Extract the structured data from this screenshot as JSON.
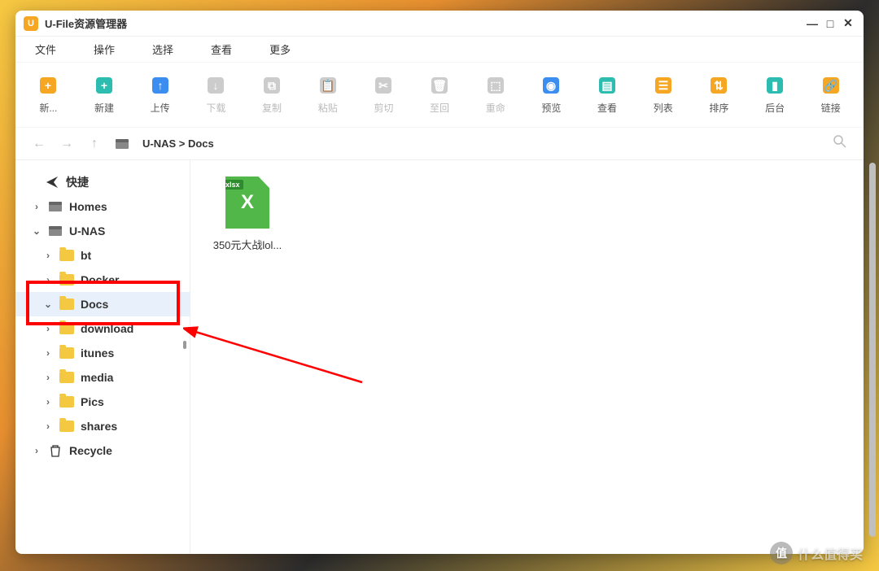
{
  "title": "U-File资源管理器",
  "titleBadge": "U",
  "windowControls": {
    "min": "—",
    "max": "□",
    "close": "✕"
  },
  "menu": [
    "文件",
    "操作",
    "选择",
    "查看",
    "更多"
  ],
  "toolbar": [
    {
      "id": "new-folder",
      "label": "新...",
      "color": "#f5a623",
      "enabled": true,
      "glyph": "+"
    },
    {
      "id": "new-file",
      "label": "新建",
      "color": "#2dbdb0",
      "enabled": true,
      "glyph": "+"
    },
    {
      "id": "upload",
      "label": "上传",
      "color": "#3b8ef0",
      "enabled": true,
      "glyph": "↑"
    },
    {
      "id": "download",
      "label": "下载",
      "color": "#ccc",
      "enabled": false,
      "glyph": "↓"
    },
    {
      "id": "copy",
      "label": "复制",
      "color": "#ccc",
      "enabled": false,
      "glyph": "⧉"
    },
    {
      "id": "paste",
      "label": "粘贴",
      "color": "#ccc",
      "enabled": false,
      "glyph": "📋"
    },
    {
      "id": "cut",
      "label": "剪切",
      "color": "#ccc",
      "enabled": false,
      "glyph": "✂"
    },
    {
      "id": "recycle",
      "label": "至回",
      "color": "#ccc",
      "enabled": false,
      "glyph": "🗑"
    },
    {
      "id": "rename",
      "label": "重命",
      "color": "#ccc",
      "enabled": false,
      "glyph": "⬚"
    },
    {
      "id": "preview",
      "label": "预览",
      "color": "#3b8ef0",
      "enabled": true,
      "glyph": "◉"
    },
    {
      "id": "view",
      "label": "查看",
      "color": "#2dbdb0",
      "enabled": true,
      "glyph": "▤"
    },
    {
      "id": "list",
      "label": "列表",
      "color": "#f5a623",
      "enabled": true,
      "glyph": "☰"
    },
    {
      "id": "sort",
      "label": "排序",
      "color": "#f5a623",
      "enabled": true,
      "glyph": "⇅"
    },
    {
      "id": "background",
      "label": "后台",
      "color": "#2dbdb0",
      "enabled": true,
      "glyph": "▮"
    },
    {
      "id": "link",
      "label": "链接",
      "color": "#f5a623",
      "enabled": true,
      "glyph": "🔗"
    }
  ],
  "breadcrumb": "U-NAS > Docs",
  "sidebar": {
    "shortcuts": {
      "label": "快捷",
      "icon": "send"
    },
    "items": [
      {
        "id": "homes",
        "label": "Homes",
        "chev": ">",
        "icon": "drive",
        "depth": 0
      },
      {
        "id": "unas",
        "label": "U-NAS",
        "chev": "v",
        "icon": "drive",
        "depth": 0
      },
      {
        "id": "bt",
        "label": "bt",
        "chev": ">",
        "icon": "folder",
        "depth": 1
      },
      {
        "id": "docker",
        "label": "Docker",
        "chev": ">",
        "icon": "folder",
        "depth": 1
      },
      {
        "id": "docs",
        "label": "Docs",
        "chev": "v",
        "icon": "folder",
        "depth": 1,
        "selected": true
      },
      {
        "id": "download",
        "label": "download",
        "chev": ">",
        "icon": "folder",
        "depth": 1
      },
      {
        "id": "itunes",
        "label": "itunes",
        "chev": ">",
        "icon": "folder",
        "depth": 1
      },
      {
        "id": "media",
        "label": "media",
        "chev": ">",
        "icon": "folder",
        "depth": 1
      },
      {
        "id": "pics",
        "label": "Pics",
        "chev": ">",
        "icon": "folder",
        "depth": 1
      },
      {
        "id": "shares",
        "label": "shares",
        "chev": ">",
        "icon": "folder",
        "depth": 1
      },
      {
        "id": "recycle",
        "label": "Recycle",
        "chev": ">",
        "icon": "trash",
        "depth": 0
      }
    ]
  },
  "files": [
    {
      "name": "350元大战lol...",
      "type": "xlsx",
      "badge": "xlsx"
    }
  ],
  "watermark": {
    "badge": "值",
    "text": "什么值得买"
  }
}
